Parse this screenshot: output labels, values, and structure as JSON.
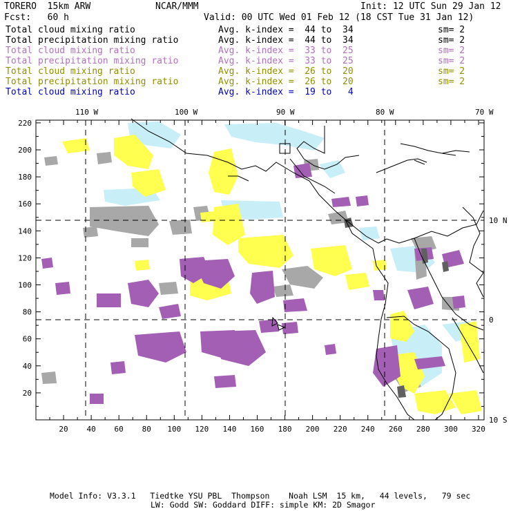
{
  "header": {
    "model": "TORERO  15km ARW",
    "org": "NCAR/MMM",
    "init": "Init: 12 UTC Sun 29 Jan 12",
    "fcst": "Fcst:   60 h",
    "valid": "Valid: 00 UTC Wed 01 Feb 12 (18 CST Tue 31 Jan 12)"
  },
  "legend_rows": [
    {
      "name": "Total cloud mixing ratio",
      "kindex": "Avg. k-index =  44 to  34",
      "sm": "sm= 2",
      "color": "#000000"
    },
    {
      "name": "Total precipitation mixing ratio",
      "kindex": "Avg. k-index =  44 to  34",
      "sm": "sm= 2",
      "color": "#000000"
    },
    {
      "name": "Total cloud mixing ratio",
      "kindex": "Avg. k-index =  33 to  25",
      "sm": "sm= 2",
      "color": "#b070c0"
    },
    {
      "name": "Total precipitation mixing ratio",
      "kindex": "Avg. k-index =  33 to  25",
      "sm": "sm= 2",
      "color": "#b070c0"
    },
    {
      "name": "Total cloud mixing ratio",
      "kindex": "Avg. k-index =  26 to  20",
      "sm": "sm= 2",
      "color": "#909000"
    },
    {
      "name": "Total precipitation mixing ratio",
      "kindex": "Avg. k-index =  26 to  20",
      "sm": "sm= 2",
      "color": "#909000"
    },
    {
      "name": "Total cloud mixing ratio",
      "kindex": "Avg. k-index =  19 to   4",
      "sm": "",
      "color": "#0000c8"
    }
  ],
  "axes": {
    "x_ticks": [
      "20",
      "40",
      "60",
      "80",
      "100",
      "120",
      "140",
      "160",
      "180",
      "200",
      "220",
      "240",
      "260",
      "280",
      "300",
      "320"
    ],
    "y_ticks": [
      "20",
      "40",
      "60",
      "80",
      "100",
      "120",
      "140",
      "160",
      "180",
      "200",
      "220"
    ],
    "lon_labels": [
      "110 W",
      "100 W",
      "90 W",
      "80 W",
      "70 W"
    ],
    "lat_labels": [
      "10 N",
      "0",
      "10 S"
    ]
  },
  "footer": {
    "line1": "Model Info: V3.3.1   Tiedtke YSU PBL  Thompson    Noah LSM  15 km,   44 levels,   79 sec",
    "line2": "LW: Godd SW: Goddard DIFF: simple KM: 2D Smagor"
  },
  "colors": {
    "gray": "#a8a8a8",
    "purple": "#a35fb4",
    "yellow": "#ffff50",
    "lightblue": "#c8eef8",
    "darkgray": "#606060"
  }
}
